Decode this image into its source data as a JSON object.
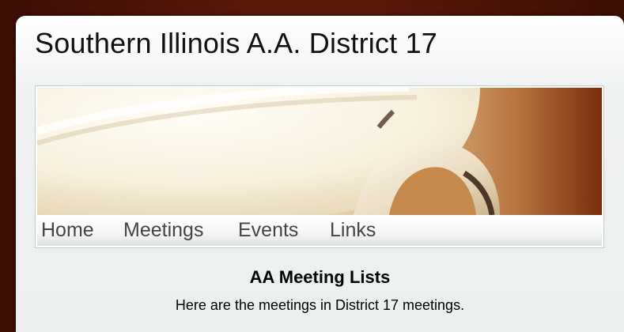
{
  "site": {
    "title": "Southern Illinois A.A. District 17"
  },
  "banner": {
    "image": "coffee-cup-banner",
    "alt": ""
  },
  "nav": {
    "items": [
      {
        "label": "Home"
      },
      {
        "label": "Meetings"
      },
      {
        "label": "Events"
      },
      {
        "label": "Links"
      }
    ]
  },
  "content": {
    "heading": "AA Meeting Lists",
    "intro": "Here are the meetings in District 17 meetings."
  },
  "colors": {
    "background": "#5a1808",
    "panel": "#eef1f2",
    "nav_text": "#444444"
  }
}
